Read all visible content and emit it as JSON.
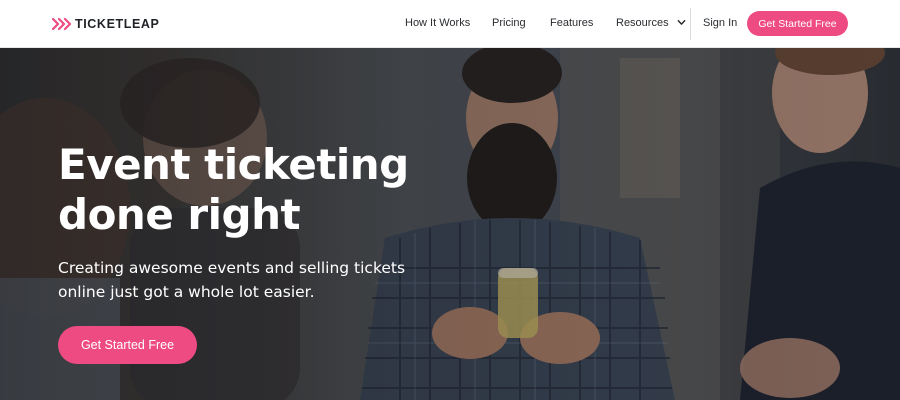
{
  "brand": {
    "name": "TICKETLEAP",
    "logo_icon": "ticketleap-arrows-icon",
    "accent_color": "#ef4b83"
  },
  "nav": {
    "items": [
      {
        "label": "How It Works"
      },
      {
        "label": "Pricing"
      },
      {
        "label": "Features"
      },
      {
        "label": "Resources"
      }
    ],
    "sign_in": "Sign In",
    "cta": "Get Started Free"
  },
  "hero": {
    "title": "Event ticketing done right",
    "subtitle": "Creating awesome events and selling tickets online just got a whole lot easier.",
    "cta": "Get Started Free"
  }
}
